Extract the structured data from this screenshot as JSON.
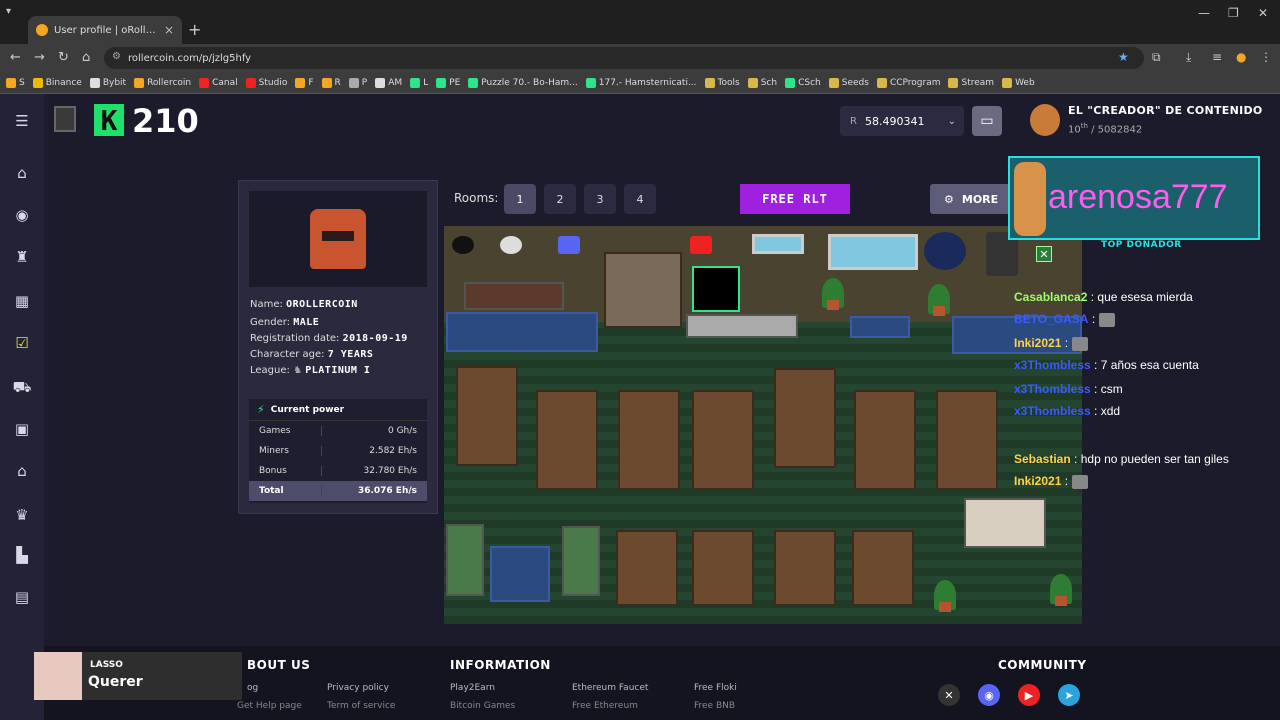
{
  "browser": {
    "tab_title": "User profile | oRollercoin | Rolle",
    "url": "rollercoin.com/p/jzlg5hfy",
    "bookmarks": [
      "S",
      "Binance",
      "Bybit",
      "Rollercoin",
      "Canal",
      "Studio",
      "F",
      "R",
      "P",
      "AM",
      "L",
      "PE",
      "Puzzle 70.- Bo-Ham...",
      "177.- Hamsternicati...",
      "Tools",
      "Sch",
      "CSch",
      "Seeds",
      "CCProgram",
      "Stream",
      "Web"
    ]
  },
  "header": {
    "level_logo": "K",
    "level": "210",
    "balance_coin": "R",
    "balance": "58.490341",
    "user_name": "EL \"CREADOR\" DE CONTENIDO",
    "user_rank_pos": "10",
    "user_rank_suffix": "th",
    "user_rank_total": "/ 5082842"
  },
  "profile": {
    "name_label": "Name:",
    "name": "OROLLERCOIN",
    "gender_label": "Gender:",
    "gender": "MALE",
    "reg_label": "Registration date:",
    "reg_date": "2018-09-19",
    "age_label": "Character age:",
    "age": "7 YEARS",
    "league_label": "League:",
    "league": "PLATINUM I",
    "power_title": "Current power",
    "power_rows": [
      {
        "label": "Games",
        "value": "0 Gh/s"
      },
      {
        "label": "Miners",
        "value": "2.582 Eh/s"
      },
      {
        "label": "Bonus",
        "value": "32.780 Eh/s"
      },
      {
        "label": "Total",
        "value": "36.076 Eh/s"
      }
    ]
  },
  "rooms": {
    "label": "Rooms:",
    "items": [
      "1",
      "2",
      "3",
      "4"
    ],
    "active": "1",
    "free_rlt": "FREE RLT",
    "more": "MORE"
  },
  "stream_overlay": {
    "donor_name": "arenosa777",
    "donor_caption": "TOP DONADOR"
  },
  "chat": [
    {
      "user": "Casablanca2",
      "text": ": que esesa mierda",
      "color": "#9cff6a"
    },
    {
      "user": "BETO_GASA",
      "text": ":",
      "color": "#3a5bff"
    },
    {
      "user": "Inki2021",
      "text": ":",
      "color": "#ffd24a"
    },
    {
      "user": "x3Thombless",
      "text": ": 7 años esa cuenta",
      "color": "#3a5bff"
    },
    {
      "user": "x3Thombless",
      "text": ": csm",
      "color": "#3a5bff"
    },
    {
      "user": "x3Thombless",
      "text": ": xdd",
      "color": "#3a5bff"
    },
    {
      "user": "Sebastian",
      "text": ": hdp no pueden ser tan giles",
      "color": "#ffd24a"
    },
    {
      "user": "Inki2021",
      "text": ":",
      "color": "#ffd24a"
    }
  ],
  "footer": {
    "about": "BOUT US",
    "information": "INFORMATION",
    "community": "COMMUNITY",
    "links_row1": [
      "og",
      "Privacy policy",
      "Play2Earn",
      "Ethereum Faucet",
      "Free Floki"
    ],
    "links_row2": [
      "Get Help page",
      "Term of service",
      "Bitcoin Games",
      "Free Ethereum",
      "Free BNB"
    ]
  },
  "music": {
    "artist": "LASSO",
    "song": "Querer"
  },
  "colors": {
    "accent_green": "#1fe06a",
    "purple": "#a020e0",
    "overlay_pink": "#ff5cf0",
    "overlay_cyan": "#29e0e0"
  }
}
